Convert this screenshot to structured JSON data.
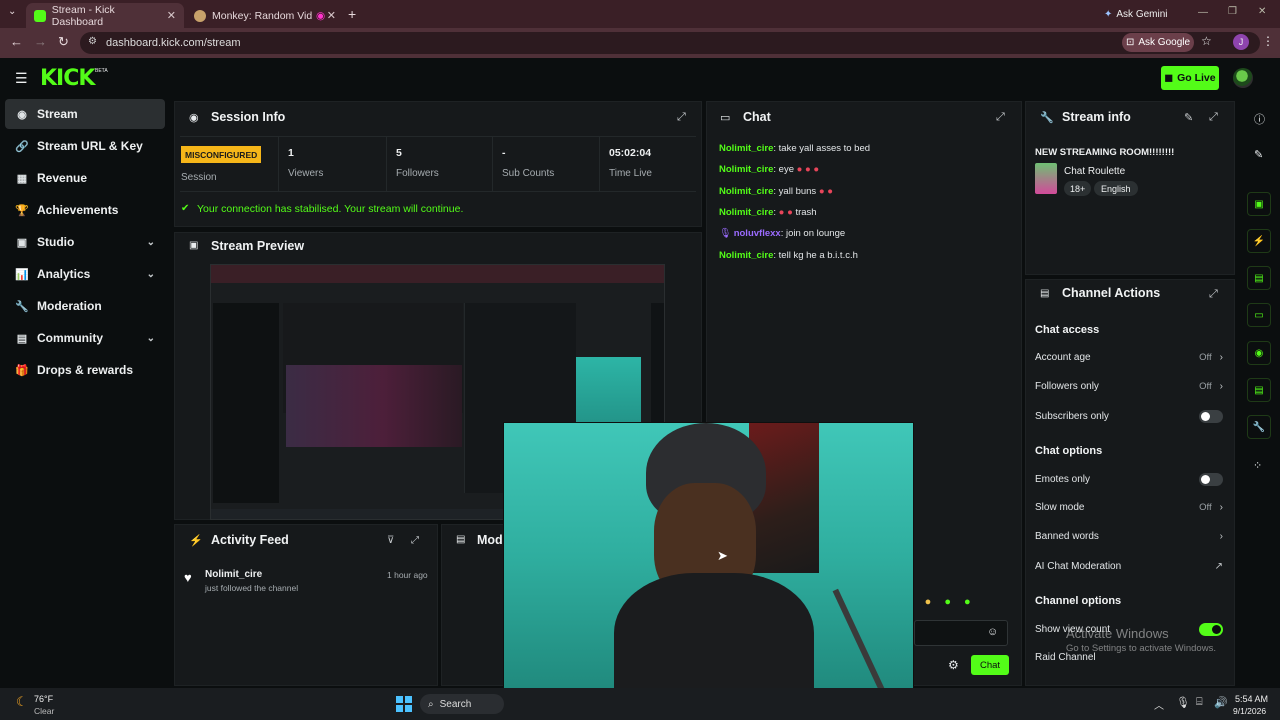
{
  "browser": {
    "tabs": [
      {
        "title": "Stream - Kick Dashboard",
        "favicon_color": "#53fc18"
      },
      {
        "title": "Monkey: Random Video Ch",
        "favicon_color": "#c8a26b"
      }
    ],
    "ask_gemini": "Ask Gemini",
    "url": "dashboard.kick.com/stream",
    "ask_google": "Ask Google",
    "profile_initial": "J"
  },
  "header": {
    "logo": "KICK",
    "logo_badge": "BETA",
    "go_live": "Go Live"
  },
  "sidebar": {
    "items": [
      {
        "label": "Stream",
        "icon": "radio-icon",
        "expandable": false
      },
      {
        "label": "Stream URL & Key",
        "icon": "link-icon",
        "expandable": false
      },
      {
        "label": "Revenue",
        "icon": "revenue-icon",
        "expandable": false
      },
      {
        "label": "Achievements",
        "icon": "trophy-icon",
        "expandable": false
      },
      {
        "label": "Studio",
        "icon": "studio-icon",
        "expandable": true
      },
      {
        "label": "Analytics",
        "icon": "analytics-icon",
        "expandable": true
      },
      {
        "label": "Moderation",
        "icon": "wrench-icon",
        "expandable": false
      },
      {
        "label": "Community",
        "icon": "community-icon",
        "expandable": true
      },
      {
        "label": "Drops & rewards",
        "icon": "gift-icon",
        "expandable": false
      }
    ]
  },
  "session": {
    "title": "Session Info",
    "status_badge": "MISCONFIGURED",
    "status_label": "Session",
    "stats": [
      {
        "value": "1",
        "label": "Viewers"
      },
      {
        "value": "5",
        "label": "Followers"
      },
      {
        "value": "-",
        "label": "Sub Counts"
      },
      {
        "value": "05:02:04",
        "label": "Time Live"
      }
    ],
    "notice": "Your connection has stabilised. Your stream will continue."
  },
  "preview": {
    "title": "Stream Preview"
  },
  "activity": {
    "title": "Activity Feed",
    "items": [
      {
        "user": "Nolimit_cire",
        "action": "just followed the channel",
        "time": "1 hour ago"
      }
    ]
  },
  "mod_panel": {
    "title": "Mod"
  },
  "chat": {
    "title": "Chat",
    "messages": [
      {
        "user": "Nolimit_cire",
        "text": "take yall asses to bed",
        "emotes": 0,
        "color": "#53fc18"
      },
      {
        "user": "Nolimit_cire",
        "text": "eye",
        "emotes": 3,
        "color": "#53fc18"
      },
      {
        "user": "Nolimit_cire",
        "text": "yall buns",
        "emotes": 2,
        "color": "#53fc18"
      },
      {
        "user": "Nolimit_cire",
        "text": "trash",
        "emotes": 2,
        "color": "#53fc18",
        "emotes_before": true
      },
      {
        "user": "noluvflexx",
        "text": "join on lounge",
        "emotes": 0,
        "color": "#9b6bff"
      },
      {
        "user": "Nolimit_cire",
        "text": "tell kg he a b.i.t.c.h",
        "emotes": 0,
        "color": "#53fc18"
      }
    ],
    "send_button": "Chat"
  },
  "stream_info": {
    "title": "Stream info",
    "stream_title": "NEW STREAMING ROOM!!!!!!!!",
    "category": "Chat Roulette",
    "tags": [
      "18+",
      "English"
    ]
  },
  "channel_actions": {
    "title": "Channel Actions",
    "chat_access_heading": "Chat access",
    "account_age": {
      "label": "Account age",
      "value": "Off"
    },
    "followers_only": {
      "label": "Followers only",
      "value": "Off"
    },
    "subscribers_only": {
      "label": "Subscribers only",
      "on": false
    },
    "chat_options_heading": "Chat options",
    "emotes_only": {
      "label": "Emotes only",
      "on": false
    },
    "slow_mode": {
      "label": "Slow mode",
      "value": "Off"
    },
    "banned_words": {
      "label": "Banned words"
    },
    "ai_moderation": {
      "label": "AI Chat Moderation"
    },
    "channel_options_heading": "Channel options",
    "show_view_count": {
      "label": "Show view count",
      "on": true
    },
    "raid_channel": {
      "label": "Raid Channel"
    }
  },
  "watermark": {
    "line1": "Activate Windows",
    "line2": "Go to Settings to activate Windows."
  },
  "taskbar": {
    "weather_temp": "76°F",
    "weather_desc": "Clear",
    "search": "Search",
    "time": "5:54 AM",
    "date": "9/1/2026"
  },
  "colors": {
    "accent": "#53fc18",
    "panel": "#16191b",
    "background": "#0b0e0f"
  }
}
